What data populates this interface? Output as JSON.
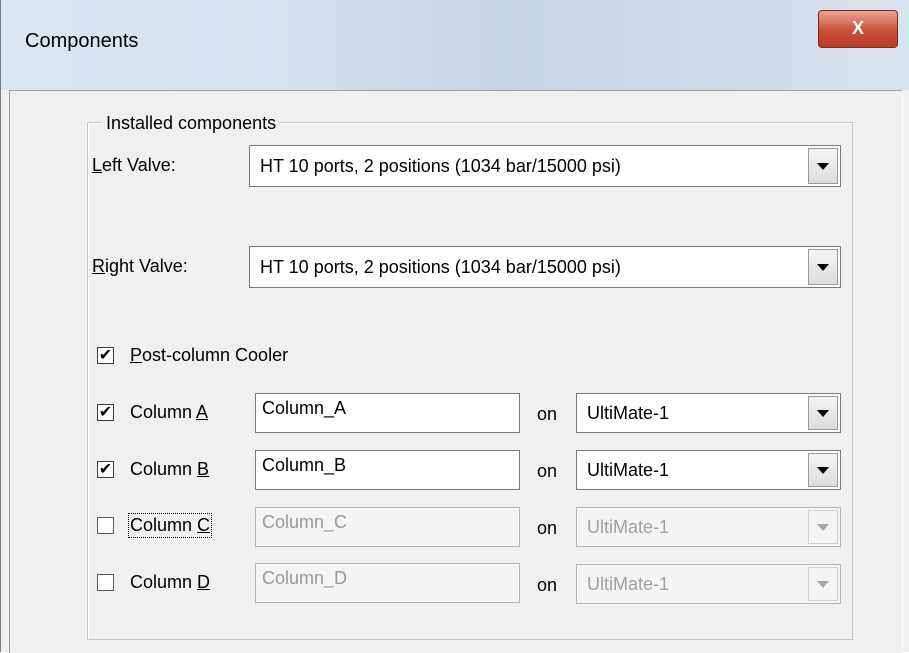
{
  "window": {
    "title": "Components",
    "close_glyph": "X"
  },
  "group": {
    "legend": "Installed components",
    "left_valve": {
      "label_key": "L",
      "label_rest": "eft Valve:",
      "value": "HT 10 ports, 2 positions (1034 bar/15000 psi)"
    },
    "right_valve": {
      "label_key": "R",
      "label_rest": "ight Valve:",
      "value": "HT 10 ports, 2 positions (1034 bar/15000 psi)"
    },
    "post_column_cooler": {
      "label_key": "P",
      "label_rest": "ost-column Cooler",
      "checked": true,
      "check_glyph": "✔"
    },
    "on_label": "on",
    "columns": [
      {
        "label_prefix": "Column ",
        "label_key": "A",
        "name": "Column_A",
        "checked": true,
        "check_glyph": "✔",
        "instrument": "UltiMate-1",
        "enabled": true
      },
      {
        "label_prefix": "Column ",
        "label_key": "B",
        "name": "Column_B",
        "checked": true,
        "check_glyph": "✔",
        "instrument": "UltiMate-1",
        "enabled": true
      },
      {
        "label_prefix": "Column ",
        "label_key": "C",
        "name": "Column_C",
        "checked": false,
        "check_glyph": "",
        "instrument": "UltiMate-1",
        "enabled": false
      },
      {
        "label_prefix": "Column ",
        "label_key": "D",
        "name": "Column_D",
        "checked": false,
        "check_glyph": "",
        "instrument": "UltiMate-1",
        "enabled": false
      }
    ]
  },
  "icons": {
    "close": "close-icon",
    "dropdown": "chevron-down-icon",
    "check": "check-icon"
  }
}
